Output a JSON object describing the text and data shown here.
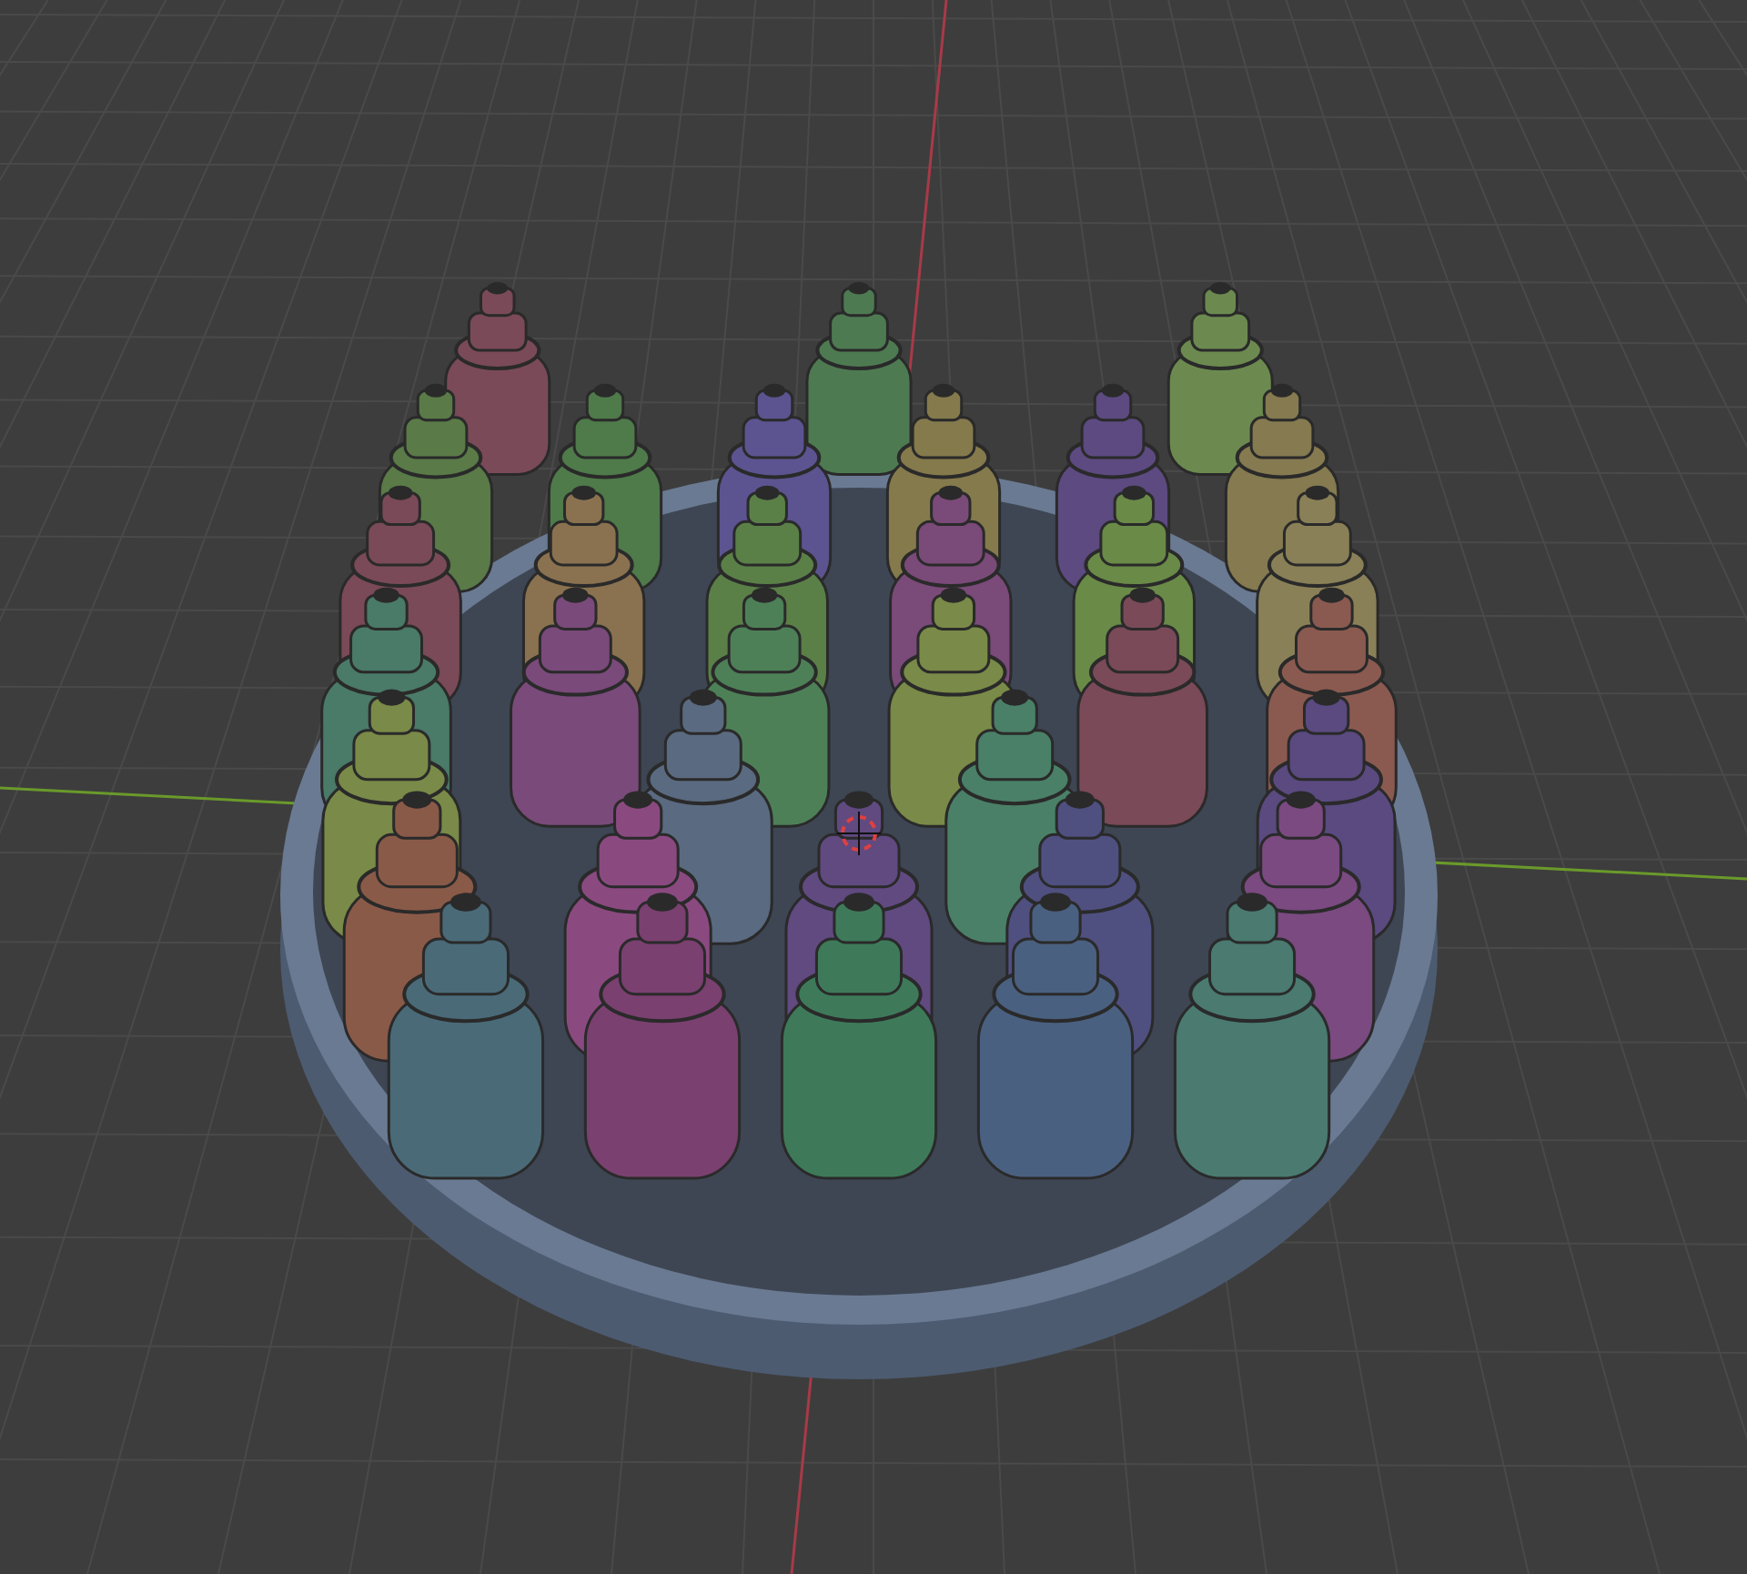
{
  "viewport": {
    "tray": {
      "rows": [
        {
          "bottles": [
            {
              "color": "#7a4a58"
            },
            {
              "color": "#4e7a52"
            },
            {
              "color": "#6c8a50"
            }
          ]
        },
        {
          "bottles": [
            {
              "color": "#5a7a48"
            },
            {
              "color": "#4f7a4a"
            },
            {
              "color": "#5c5490"
            },
            {
              "color": "#857a4c"
            },
            {
              "color": "#5c4a80"
            },
            {
              "color": "#857a50"
            }
          ]
        },
        {
          "bottles": [
            {
              "color": "#7a4a58"
            },
            {
              "color": "#8a7250"
            },
            {
              "color": "#5a8048"
            },
            {
              "color": "#7a4a78"
            },
            {
              "color": "#6a8a48"
            },
            {
              "color": "#8a8058"
            }
          ]
        },
        {
          "bottles": [
            {
              "color": "#4a7a68"
            },
            {
              "color": "#7a4a7a"
            },
            {
              "color": "#4e8058"
            },
            {
              "color": "#7a8a48"
            },
            {
              "color": "#7a4a58"
            },
            {
              "color": "#8a5a50"
            }
          ]
        },
        {
          "bottles": [
            {
              "color": "#7a8a48"
            },
            {
              "color": "#5a6a80"
            },
            {
              "color": "#4a8068"
            },
            {
              "color": "#5a4a80"
            }
          ]
        },
        {
          "bottles": [
            {
              "color": "#8a5a48"
            },
            {
              "color": "#8a4a80"
            },
            {
              "color": "#604a80"
            },
            {
              "color": "#4f5080"
            },
            {
              "color": "#7a4a80"
            }
          ]
        },
        {
          "bottles": [
            {
              "color": "#4a6a78"
            },
            {
              "color": "#7a4070"
            },
            {
              "color": "#3e7a5a"
            },
            {
              "color": "#4a6080"
            },
            {
              "color": "#4a7a70"
            }
          ]
        }
      ]
    }
  }
}
